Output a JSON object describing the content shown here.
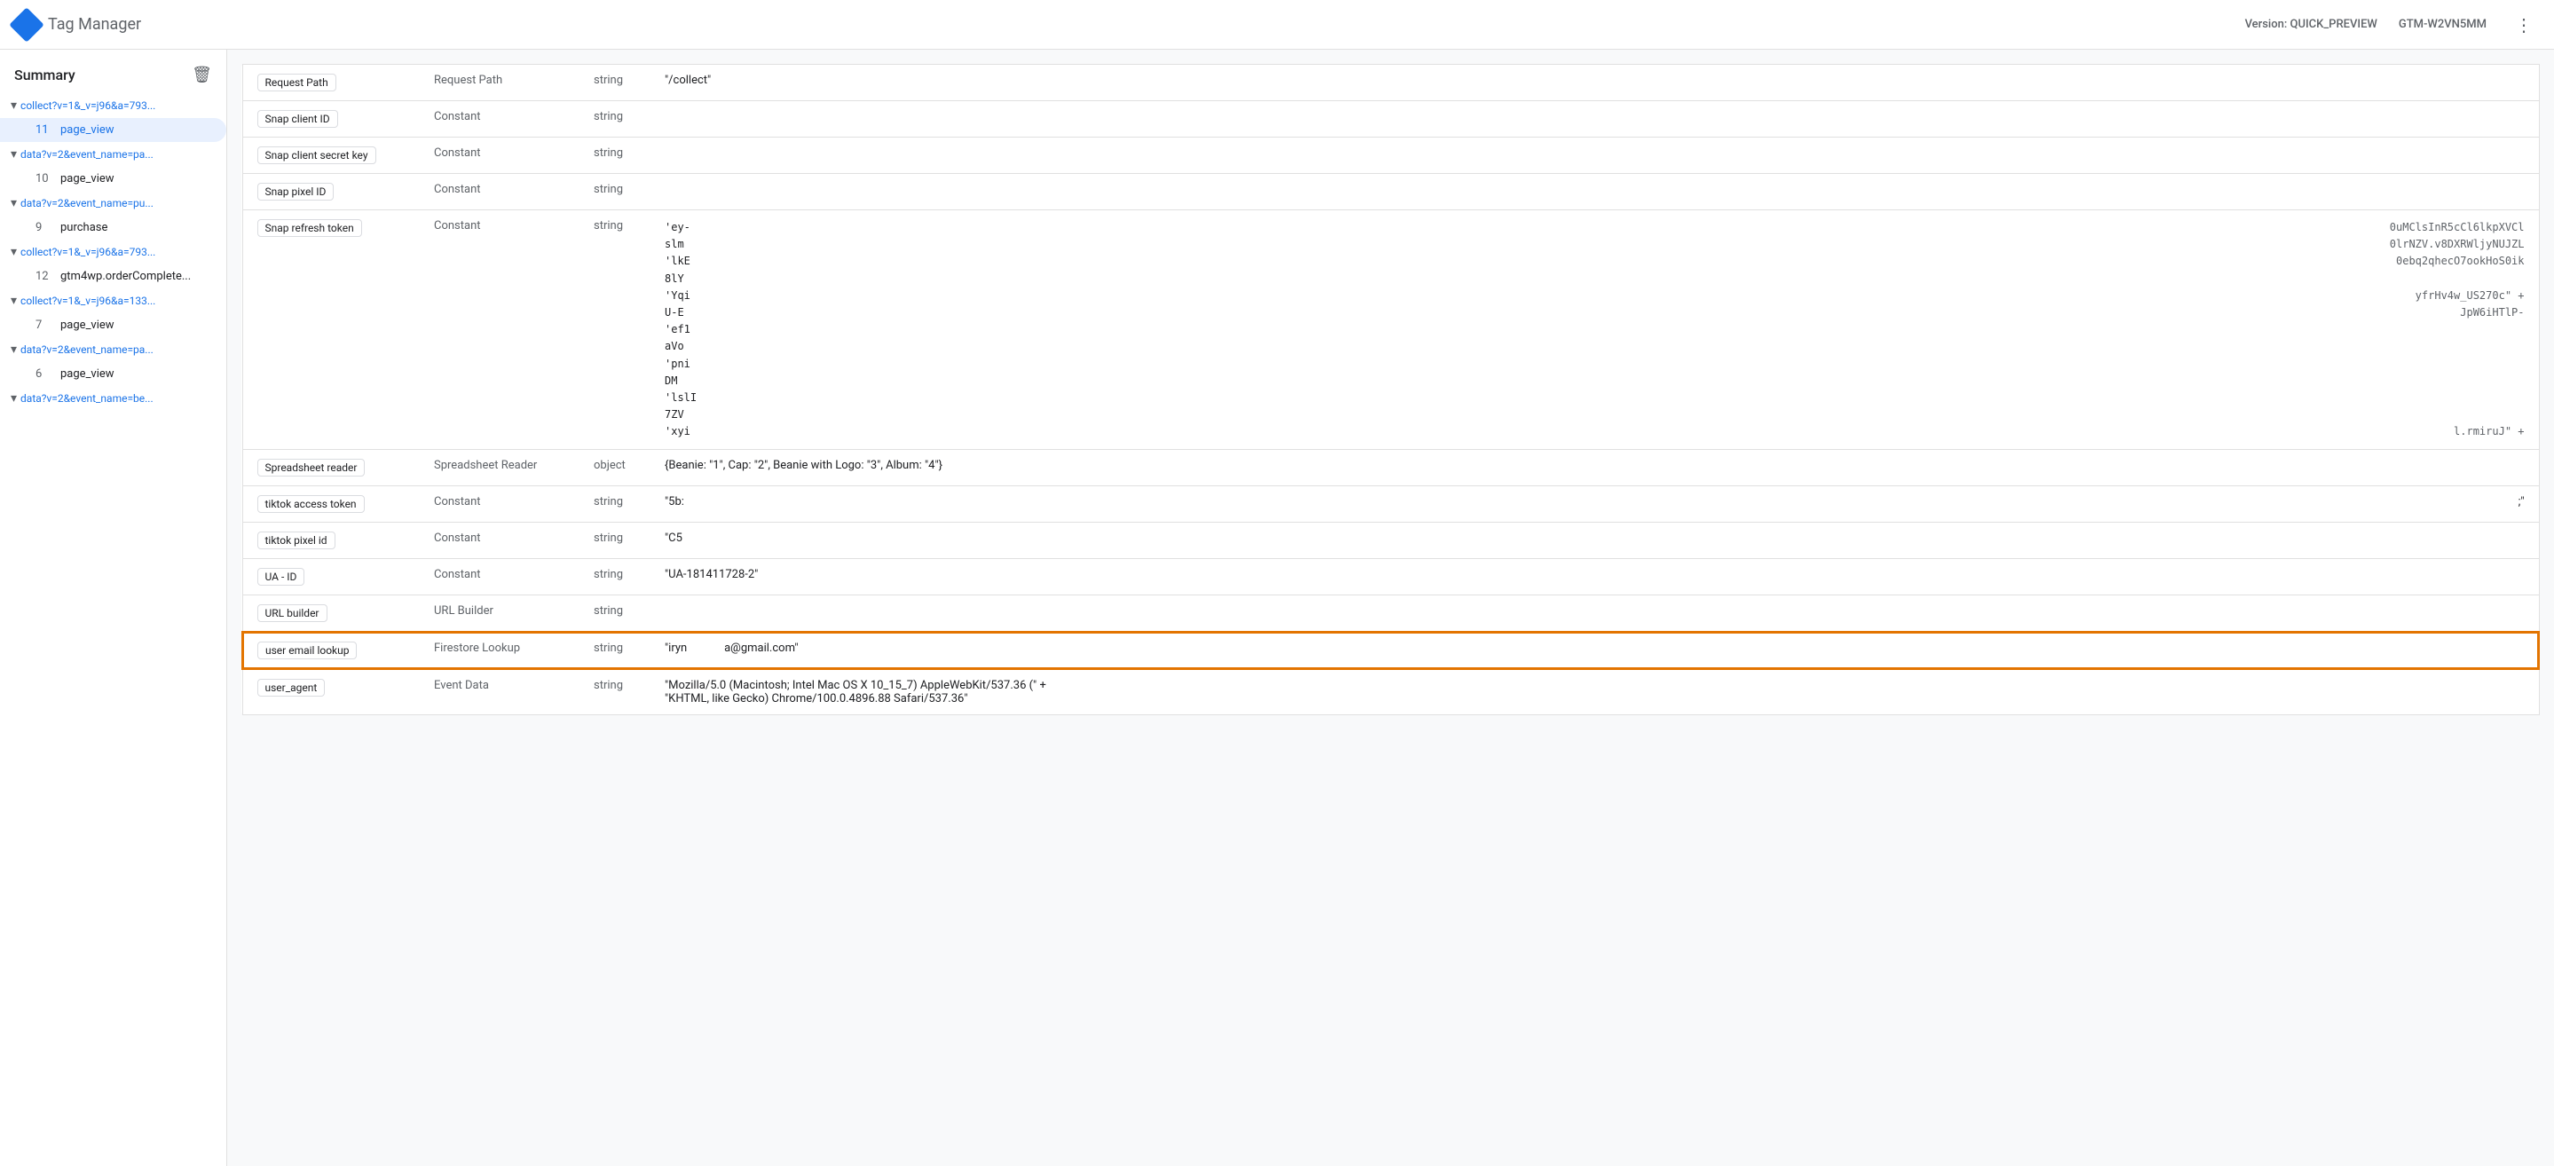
{
  "header": {
    "app_name": "Tag Manager",
    "version_label": "Version: QUICK_PREVIEW",
    "gtm_id": "GTM-W2VN5MM"
  },
  "sidebar": {
    "summary_label": "Summary",
    "delete_icon": "delete-icon",
    "groups": [
      {
        "id": "group1",
        "parent_label": "collect?v=1&_v=j96&a=793...",
        "expanded": true,
        "children": [
          {
            "num": "11",
            "label": "page_view",
            "active": true
          }
        ]
      },
      {
        "id": "group2",
        "parent_label": "data?v=2&event_name=pa...",
        "expanded": true,
        "children": [
          {
            "num": "10",
            "label": "page_view",
            "active": false
          }
        ]
      },
      {
        "id": "group3",
        "parent_label": "data?v=2&event_name=pu...",
        "expanded": true,
        "children": [
          {
            "num": "9",
            "label": "purchase",
            "active": false
          }
        ]
      },
      {
        "id": "group4",
        "parent_label": "collect?v=1&_v=j96&a=793...",
        "expanded": true,
        "children": [
          {
            "num": "12",
            "label": "gtm4wp.orderComplete...",
            "active": false
          }
        ]
      },
      {
        "id": "group5",
        "parent_label": "collect?v=1&_v=j96&a=133...",
        "expanded": true,
        "children": [
          {
            "num": "7",
            "label": "page_view",
            "active": false
          }
        ]
      },
      {
        "id": "group6",
        "parent_label": "data?v=2&event_name=pa...",
        "expanded": true,
        "children": [
          {
            "num": "6",
            "label": "page_view",
            "active": false
          }
        ]
      },
      {
        "id": "group7",
        "parent_label": "data?v=2&event_name=be...",
        "expanded": false,
        "children": []
      }
    ]
  },
  "table": {
    "rows": [
      {
        "id": "row-request-path",
        "name": "Request Path",
        "type": "Request Path",
        "data_type": "string",
        "value": "\"/collect\"",
        "value_right": "",
        "highlighted": false
      },
      {
        "id": "row-snap-client-id",
        "name": "Snap client ID",
        "type": "Constant",
        "data_type": "string",
        "value": "",
        "value_right": "",
        "highlighted": false
      },
      {
        "id": "row-snap-client-secret",
        "name": "Snap client secret key",
        "type": "Constant",
        "data_type": "string",
        "value": "",
        "value_right": "",
        "highlighted": false
      },
      {
        "id": "row-snap-pixel-id",
        "name": "Snap pixel ID",
        "type": "Constant",
        "data_type": "string",
        "value": "",
        "value_right": "",
        "highlighted": false
      },
      {
        "id": "row-snap-refresh",
        "name": "Snap refresh token",
        "type": "Constant",
        "data_type": "string",
        "value_lines": [
          "'ey-",
          "slm",
          "'lkE",
          "8lY",
          "'Yqi",
          "U-E",
          "'ef1",
          "aVo",
          "'pni",
          "DM",
          "'lslI",
          "7ZV",
          "'xyi"
        ],
        "value_right_lines": [
          "0uMClsInR5cCl6lkpXVCl",
          "0lrNZV.v8DXRWljyNUJZL",
          "0ebq2qhecO7ookHoS0ik",
          "",
          "yfrHv4w_US270c\" +",
          "JpW6iHTlP-",
          "",
          "",
          "",
          "",
          "",
          "",
          "l.rmiruJ\" +"
        ],
        "highlighted": false
      },
      {
        "id": "row-spreadsheet-reader",
        "name": "Spreadsheet reader",
        "type": "Spreadsheet Reader",
        "data_type": "object",
        "value": "{Beanie: \"1\", Cap: \"2\", Beanie with Logo: \"3\", Album: \"4\"}",
        "value_right": "",
        "highlighted": false
      },
      {
        "id": "row-tiktok-access",
        "name": "tiktok access token",
        "type": "Constant",
        "data_type": "string",
        "value": "\"5b:",
        "value_right": ";\"",
        "highlighted": false
      },
      {
        "id": "row-tiktok-pixel",
        "name": "tiktok pixel id",
        "type": "Constant",
        "data_type": "string",
        "value": "\"C5",
        "value_right": "",
        "highlighted": false
      },
      {
        "id": "row-ua-id",
        "name": "UA - ID",
        "type": "Constant",
        "data_type": "string",
        "value": "\"UA-181411728-2\"",
        "value_right": "",
        "highlighted": false
      },
      {
        "id": "row-url-builder",
        "name": "URL builder",
        "type": "URL Builder",
        "data_type": "string",
        "value": "",
        "value_right": "",
        "highlighted": false
      },
      {
        "id": "row-user-email",
        "name": "user email lookup",
        "type": "Firestore Lookup",
        "data_type": "string",
        "value": "\"iryn                a@gmail.com\"",
        "value_right": "",
        "highlighted": true
      },
      {
        "id": "row-user-agent",
        "name": "user_agent",
        "type": "Event Data",
        "data_type": "string",
        "value": "\"Mozilla/5.0 (Macintosh; Intel Mac OS X 10_15_7) AppleWebKit/537.36 (\" +\n\"KHTML, like Gecko) Chrome/100.0.4896.88 Safari/537.36\"",
        "value_right": "",
        "highlighted": false
      }
    ]
  }
}
